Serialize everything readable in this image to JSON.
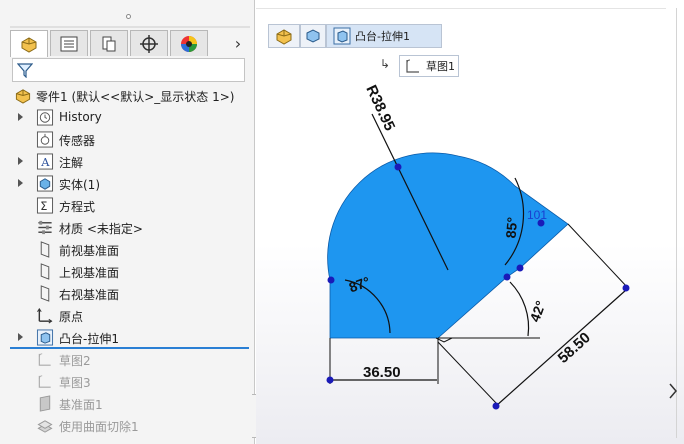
{
  "feature_manager": {
    "tabs": [
      {
        "name": "featuremanager-tab",
        "icon": "part-icon"
      },
      {
        "name": "propertymanager-tab",
        "icon": "list-icon"
      },
      {
        "name": "configuration-tab",
        "icon": "configuration-icon"
      },
      {
        "name": "dimxpert-tab",
        "icon": "crosshair-icon"
      },
      {
        "name": "display-tab",
        "icon": "appearance-icon"
      }
    ],
    "more_tabs": "›",
    "root": {
      "label": "零件1  (默认<<默认>_显示状态 1>)"
    },
    "items": [
      {
        "label": "History",
        "icon": "history-icon",
        "expandable": true
      },
      {
        "label": "传感器",
        "icon": "sensor-icon",
        "expandable": false
      },
      {
        "label": "注解",
        "icon": "annotation-icon",
        "expandable": true
      },
      {
        "label": "实体(1)",
        "icon": "solid-body-icon",
        "expandable": true
      },
      {
        "label": "方程式",
        "icon": "equation-icon",
        "expandable": false
      },
      {
        "label": "材质 <未指定>",
        "icon": "material-icon",
        "expandable": false
      },
      {
        "label": "前视基准面",
        "icon": "plane-icon",
        "expandable": false
      },
      {
        "label": "上视基准面",
        "icon": "plane-icon",
        "expandable": false
      },
      {
        "label": "右视基准面",
        "icon": "plane-icon",
        "expandable": false
      },
      {
        "label": "原点",
        "icon": "origin-icon",
        "expandable": false
      },
      {
        "label": "凸台-拉伸1",
        "icon": "extrude-icon",
        "expandable": true,
        "selected": true
      },
      {
        "label": "草图2",
        "icon": "sketch-icon",
        "dim": true
      },
      {
        "label": "草图3",
        "icon": "sketch-icon",
        "dim": true
      },
      {
        "label": "基准面1",
        "icon": "plane-icon",
        "dim": true
      },
      {
        "label": "使用曲面切除1",
        "icon": "surface-cut-icon",
        "dim": true
      }
    ]
  },
  "breadcrumb": {
    "feature": "凸台-拉伸1",
    "sketch": "草图1"
  },
  "sketch": {
    "fill_color": "#1E96F0",
    "dimensions": {
      "radius": "R38.95",
      "angle_top": "85°",
      "angle_left": "87°",
      "angle_right": "42°",
      "diagonal": "58.50",
      "bottom": "36.50",
      "extra": "101"
    }
  }
}
